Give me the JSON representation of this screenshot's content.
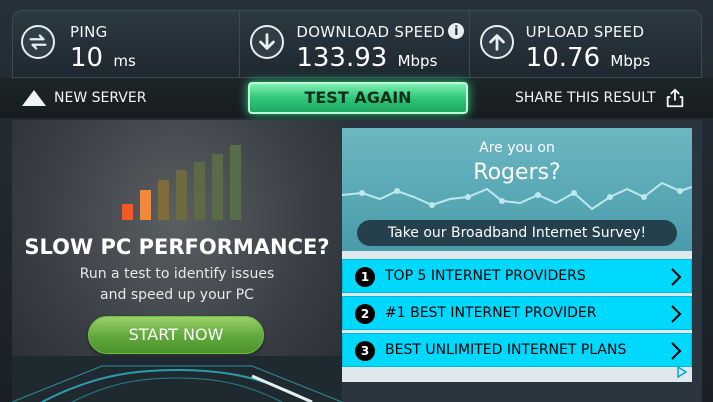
{
  "stats": {
    "ping": {
      "label": "PING",
      "value": "10",
      "unit": "ms",
      "icon": "ping-arrows-icon"
    },
    "download": {
      "label": "DOWNLOAD SPEED",
      "value": "133.93",
      "unit": "Mbps",
      "icon": "download-arrow-icon",
      "info": "i"
    },
    "upload": {
      "label": "UPLOAD SPEED",
      "value": "10.76",
      "unit": "Mbps",
      "icon": "upload-arrow-icon"
    }
  },
  "actions": {
    "new_server": "NEW SERVER",
    "test_again": "TEST AGAIN",
    "share": "SHARE THIS RESULT"
  },
  "left_ad": {
    "title": "SLOW PC PERFORMANCE?",
    "line1": "Run a test to identify issues",
    "line2": "and speed up your PC",
    "button": "START NOW"
  },
  "right_ad": {
    "question_line1": "Are you on",
    "question_line2": "Rogers?",
    "survey_button": "Take our Broadband Internet Survey!",
    "links": [
      {
        "num": "1",
        "label": "TOP 5 INTERNET PROVIDERS"
      },
      {
        "num": "2",
        "label": "#1 BEST INTERNET PROVIDER"
      },
      {
        "num": "3",
        "label": "BEST UNLIMITED INTERNET PLANS"
      }
    ]
  },
  "colors": {
    "accent_green": "#2fc77a",
    "link_cyan": "#00d9ff",
    "survey_teal": "#5aa9b6",
    "bar_orange": "#f05a28"
  }
}
